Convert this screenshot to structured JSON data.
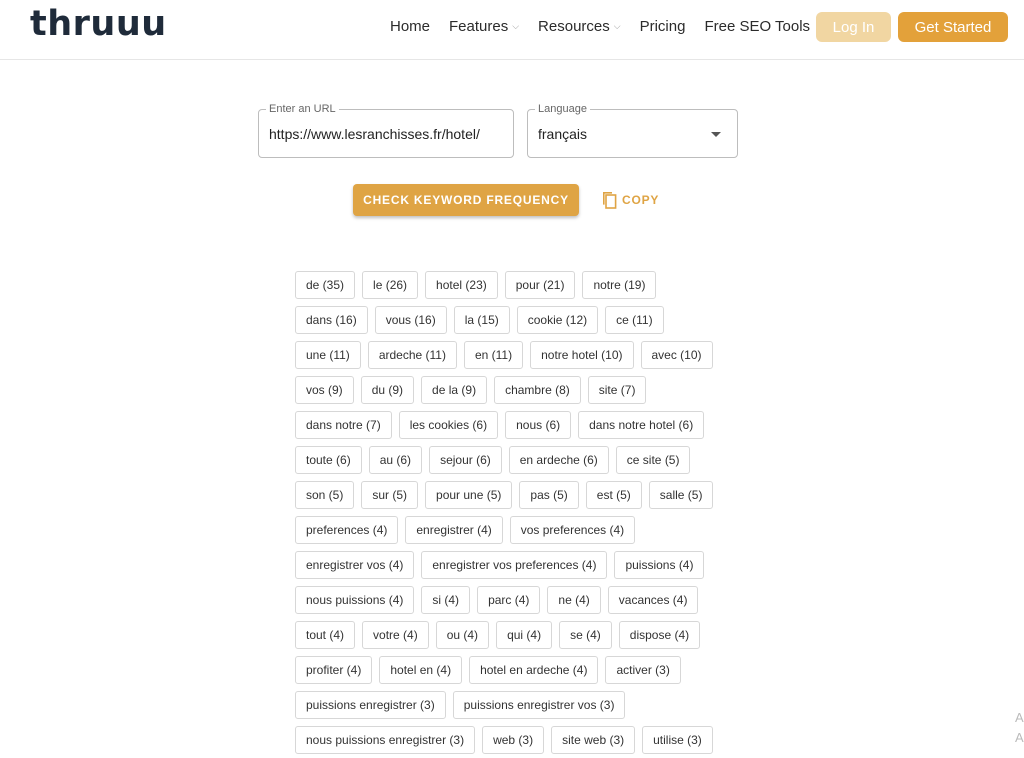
{
  "header": {
    "logo": "thruuu",
    "nav": [
      {
        "label": "Home",
        "dropdown": false
      },
      {
        "label": "Features",
        "dropdown": true
      },
      {
        "label": "Resources",
        "dropdown": true
      },
      {
        "label": "Pricing",
        "dropdown": false
      },
      {
        "label": "Free SEO Tools",
        "dropdown": false
      }
    ],
    "login_label": "Log In",
    "get_started_label": "Get Started"
  },
  "form": {
    "url_label": "Enter an URL",
    "url_value": "https://www.lesranchisses.fr/hotel/",
    "language_label": "Language",
    "language_value": "français",
    "check_button": "CHECK KEYWORD FREQUENCY",
    "copy_button": "COPY"
  },
  "tag_rows": [
    [
      "de (35)",
      "le (26)",
      "hotel (23)",
      "pour (21)",
      "notre (19)"
    ],
    [
      "dans (16)",
      "vous (16)",
      "la (15)",
      "cookie (12)",
      "ce (11)"
    ],
    [
      "une (11)",
      "ardeche (11)",
      "en (11)",
      "notre hotel (10)",
      "avec (10)"
    ],
    [
      "vos (9)",
      "du (9)",
      "de la (9)",
      "chambre (8)",
      "site (7)"
    ],
    [
      "dans notre (7)",
      "les cookies (6)",
      "nous (6)",
      "dans notre hotel (6)"
    ],
    [
      "toute (6)",
      "au (6)",
      "sejour (6)",
      "en ardeche (6)",
      "ce site (5)"
    ],
    [
      "son (5)",
      "sur (5)",
      "pour une (5)",
      "pas (5)",
      "est (5)",
      "salle (5)"
    ],
    [
      "preferences (4)",
      "enregistrer (4)",
      "vos preferences (4)"
    ],
    [
      "enregistrer vos (4)",
      "enregistrer vos preferences (4)",
      "puissions (4)"
    ],
    [
      "nous puissions (4)",
      "si (4)",
      "parc (4)",
      "ne (4)",
      "vacances (4)"
    ],
    [
      "tout (4)",
      "votre (4)",
      "ou (4)",
      "qui (4)",
      "se (4)",
      "dispose (4)"
    ],
    [
      "profiter (4)",
      "hotel en (4)",
      "hotel en ardeche (4)",
      "activer (3)"
    ],
    [
      "puissions enregistrer (3)",
      "puissions enregistrer vos (3)"
    ],
    [
      "nous puissions enregistrer (3)",
      "web (3)",
      "site web (3)",
      "utilise (3)"
    ]
  ],
  "edge_text": [
    "A",
    "A"
  ],
  "colors": {
    "accent": "#e3a13a",
    "login_disabled": "#f1d6a2",
    "logo": "#1f2b3a"
  }
}
